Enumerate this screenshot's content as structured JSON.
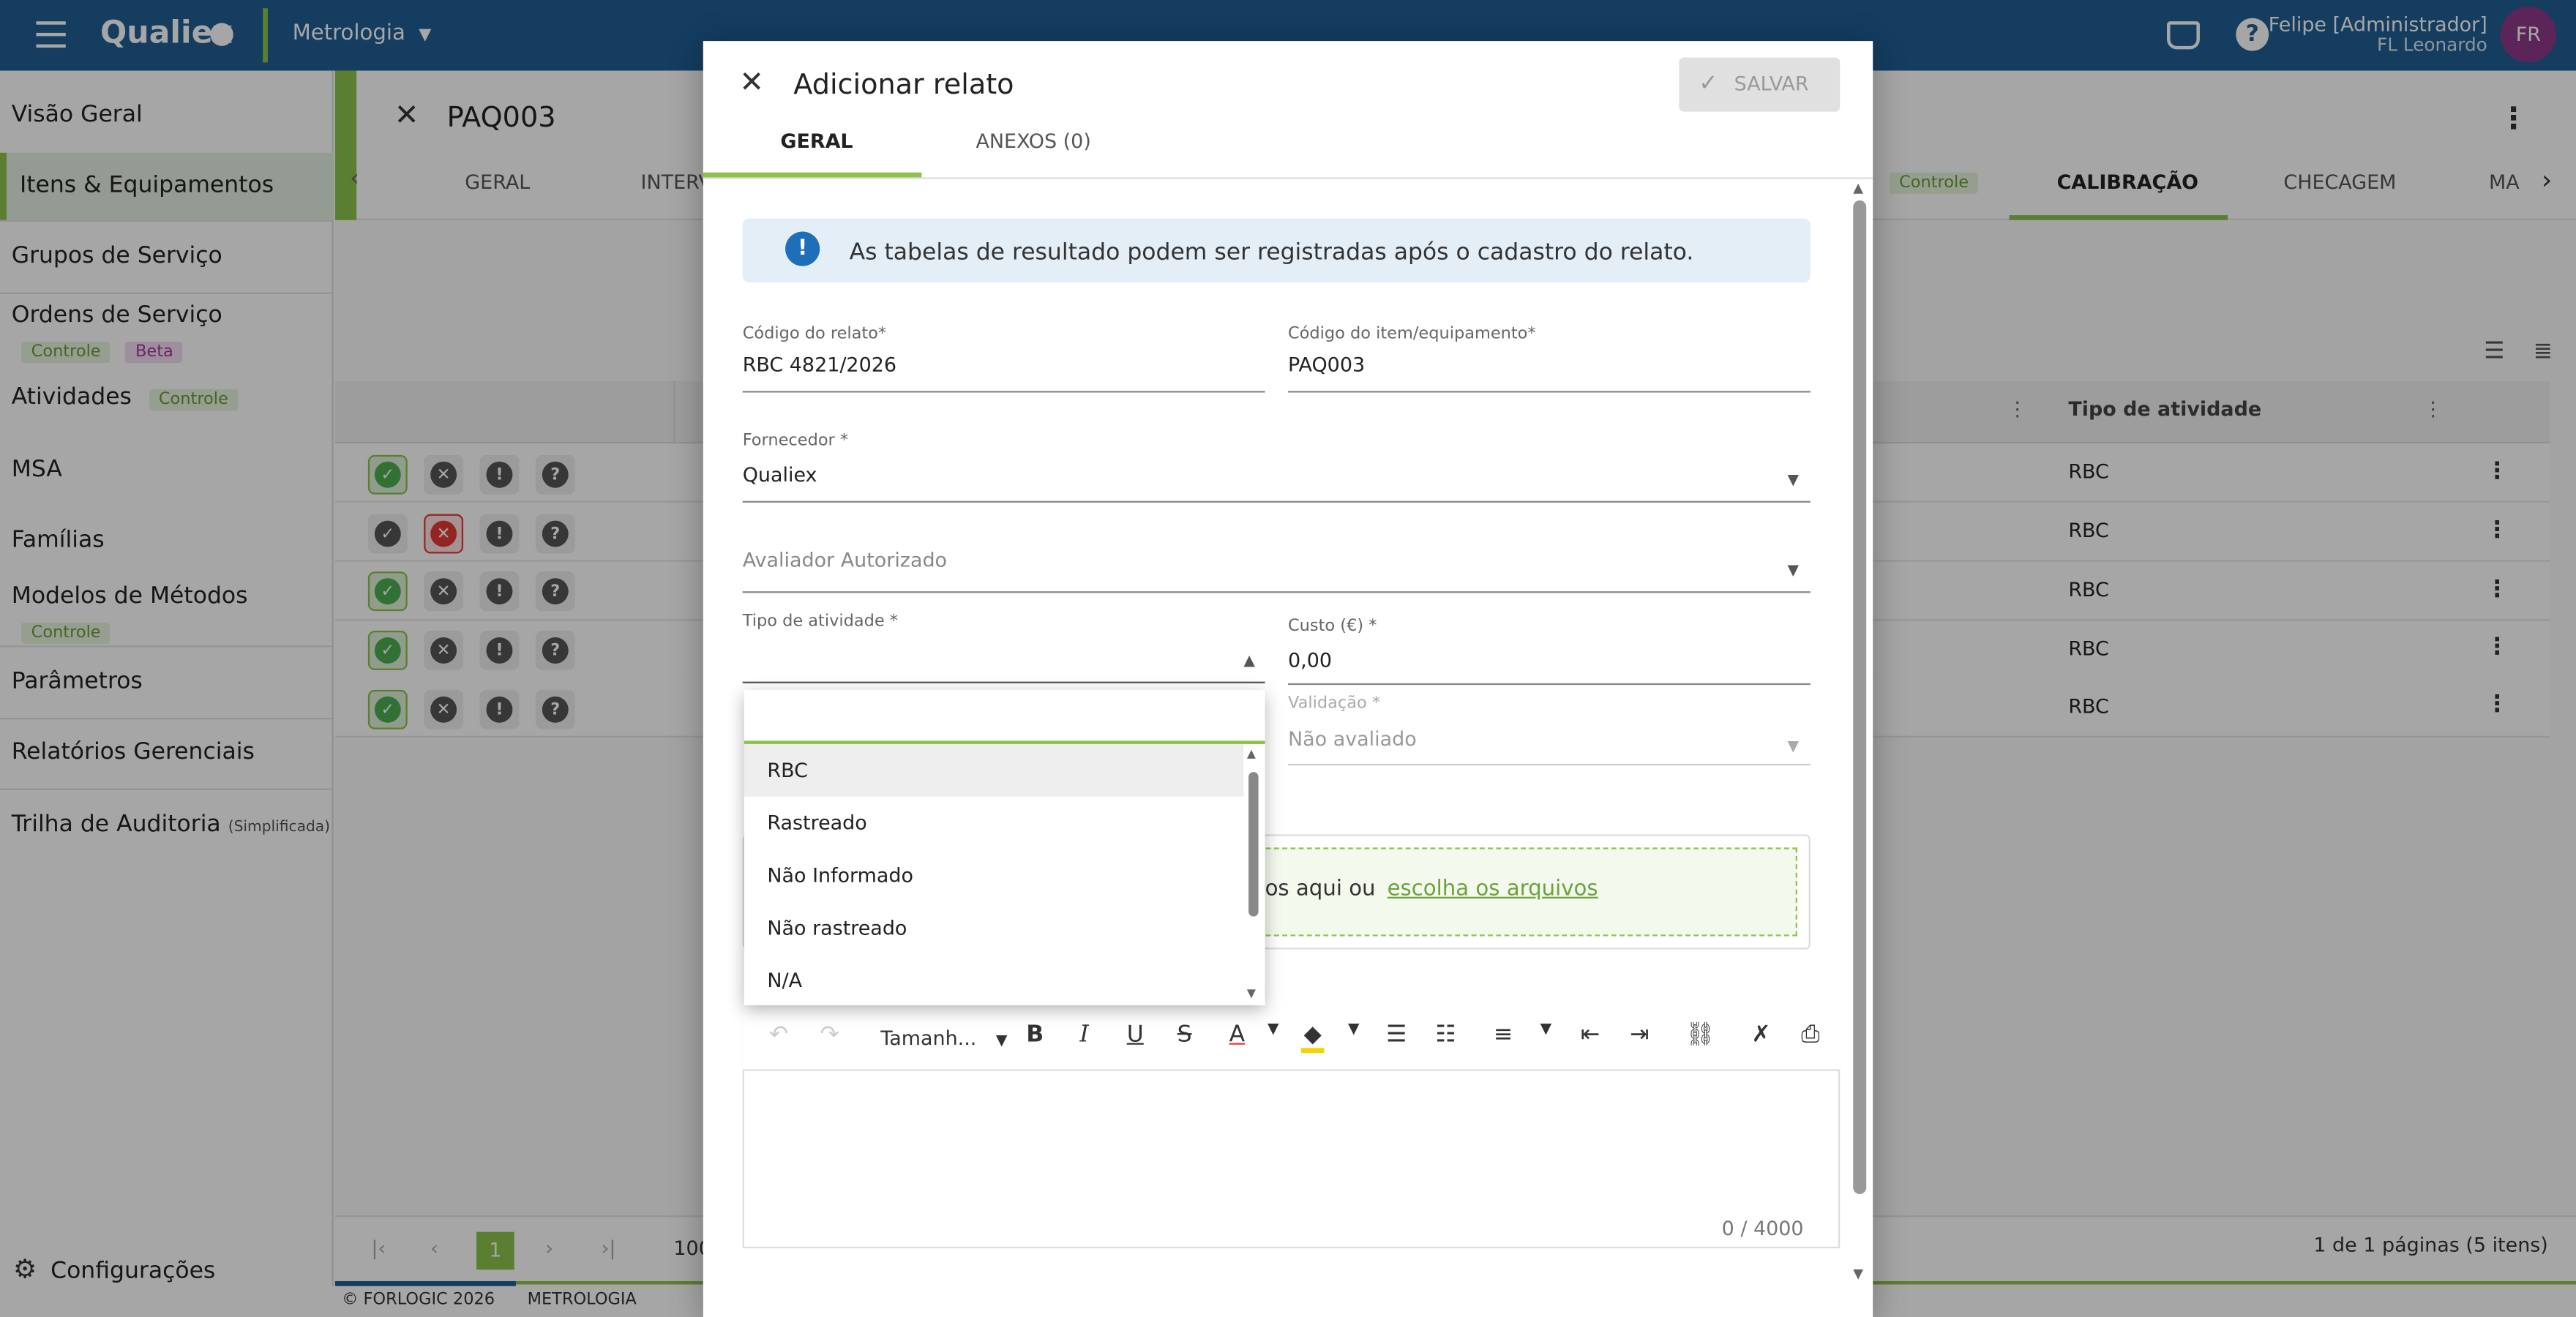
{
  "header": {
    "brand": "Qualiex",
    "module": "Metrologia",
    "user_name": "Felipe [Administrador]",
    "user_company": "FL Leonardo",
    "avatar_initials": "FR"
  },
  "sidebar": {
    "items": [
      {
        "label": "Visão Geral"
      },
      {
        "label": "Itens & Equipamentos"
      },
      {
        "label": "Grupos de Serviço"
      },
      {
        "label": "Ordens de Serviço",
        "badges": [
          "Controle",
          "Beta"
        ]
      },
      {
        "label": "Atividades",
        "badges": [
          "Controle"
        ]
      },
      {
        "label": "MSA"
      },
      {
        "label": "Famílias"
      },
      {
        "label": "Modelos de Métodos",
        "badges": [
          "Controle"
        ]
      },
      {
        "label": "Parâmetros"
      },
      {
        "label": "Relatórios Gerenciais"
      },
      {
        "label": "Trilha de Auditoria",
        "suffix": "(Simplificada)"
      }
    ],
    "settings_label": "Configurações"
  },
  "item": {
    "code": "PAQ003",
    "tabs": [
      "GERAL",
      "INTERV",
      "Controle",
      "CALIBRAÇÃO",
      "CHECAGEM",
      "MA"
    ]
  },
  "table": {
    "col_tipo": "Tipo de atividade",
    "rows": [
      {
        "tipo": "RBC"
      },
      {
        "tipo": "RBC"
      },
      {
        "tipo": "RBC"
      },
      {
        "tipo": "RBC"
      },
      {
        "tipo": "RBC"
      }
    ],
    "pager": {
      "current": "1",
      "page_size": "100",
      "summary": "1 de 1 páginas (5 itens)"
    }
  },
  "footer": {
    "copyright": "© FORLOGIC 2026",
    "module": "METROLOGIA"
  },
  "modal": {
    "title": "Adicionar relato",
    "save_label": "SALVAR",
    "tabs": [
      "GERAL",
      "ANEXOS (0)"
    ],
    "info": "As tabelas de resultado podem ser registradas após o cadastro do relato.",
    "fields": {
      "codigo_relato": {
        "label": "Código do relato*",
        "value": "RBC 4821/2026"
      },
      "codigo_item": {
        "label": "Código do item/equipamento*",
        "value": "PAQ003"
      },
      "fornecedor": {
        "label": "Fornecedor *",
        "value": "Qualiex"
      },
      "avaliador": {
        "label": "Avaliador Autorizado"
      },
      "tipo": {
        "label": "Tipo de atividade *",
        "value": ""
      },
      "custo": {
        "label": "Custo (€) *",
        "value": "0,00"
      },
      "validacao": {
        "label": "Validação *",
        "value": "Não avaliado"
      }
    },
    "upload_text": "os aqui ou",
    "upload_link": "escolha os arquivos",
    "editor": {
      "font_size": "Tamanh...",
      "counter": "0 / 4000"
    }
  },
  "dropdown": {
    "search_value": "",
    "options": [
      "RBC",
      "Rastreado",
      "Não Informado",
      "Não rastreado",
      "N/A"
    ]
  },
  "colors": {
    "primary": "#1f5e94",
    "accent": "#8bc34a",
    "info_bg": "#e3eef7",
    "info_icon": "#1f6fb8"
  }
}
